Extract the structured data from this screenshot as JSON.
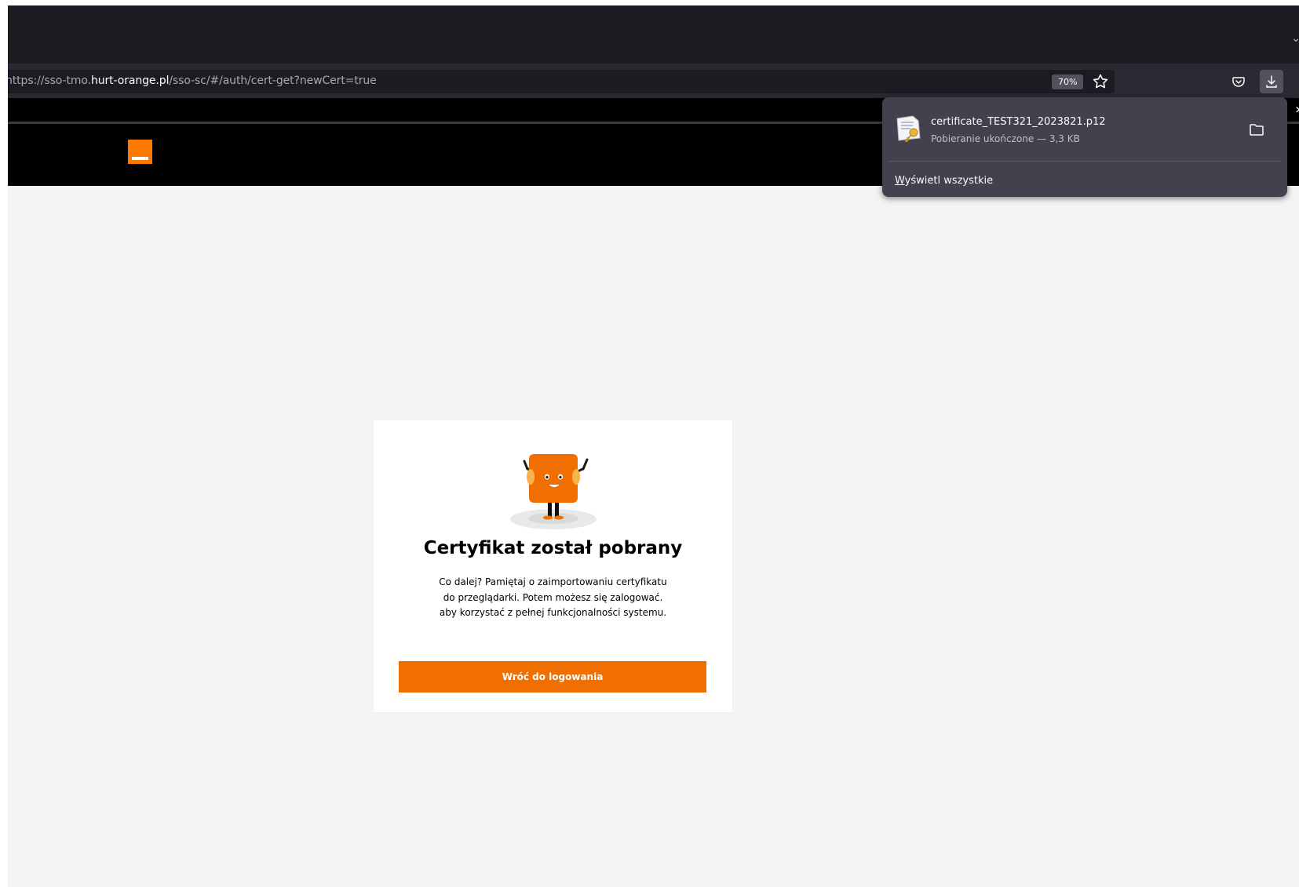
{
  "browser": {
    "url": {
      "prefix": "nttps://sso-tmo.",
      "host": "hurt-orange.pl",
      "path": "/sso-sc/#/auth/cert-get?newCert=true"
    },
    "zoom_label": "70%",
    "more_label": "»"
  },
  "downloads": {
    "file_name": "certificate_TEST321_2023821.p12",
    "status": "Pobieranie ukończone — 3,3 KB",
    "show_all_label": "Wyświetl wszystkie"
  },
  "site": {
    "brand_color": "#ff7900"
  },
  "card": {
    "title": "Certyfikat został pobrany",
    "description": [
      "Co dalej? Pamiętaj o zaimportowaniu certyfikatu",
      "do przeglądarki. Potem możesz się zalogować.",
      "aby korzystać z pełnej funkcjonalności systemu."
    ],
    "button_label": "Wróć do logowania",
    "button_color": "#f16e00"
  }
}
